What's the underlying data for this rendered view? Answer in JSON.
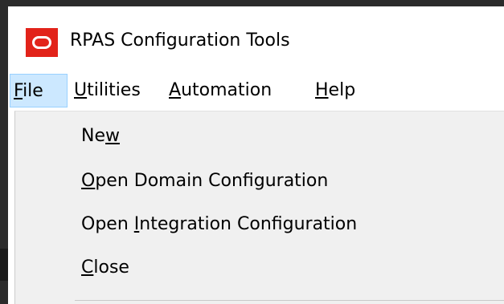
{
  "window": {
    "title": "RPAS Configuration Tools",
    "logo_icon": "oracle-logo-icon",
    "logo_color": "#e2231a"
  },
  "menu_bar": {
    "items": [
      {
        "label_accel": "F",
        "label_rest": "ile",
        "active": true
      },
      {
        "label_accel": "U",
        "label_rest": "tilities",
        "active": false
      },
      {
        "label_accel": "A",
        "label_rest": "utomation",
        "active": false
      },
      {
        "label_accel": "H",
        "label_rest": "elp",
        "active": false
      }
    ]
  },
  "file_menu": {
    "items": [
      {
        "pre": "Ne",
        "accel": "w",
        "post": ""
      },
      {
        "pre": "",
        "accel": "O",
        "post": "pen Domain Configuration"
      },
      {
        "pre": "Open ",
        "accel": "I",
        "post": "ntegration Configuration"
      },
      {
        "pre": "",
        "accel": "C",
        "post": "lose"
      }
    ]
  },
  "colors": {
    "menu_highlight": "#cce8ff",
    "menu_highlight_border": "#99d1ff",
    "dropdown_bg": "#f0f0f0"
  }
}
